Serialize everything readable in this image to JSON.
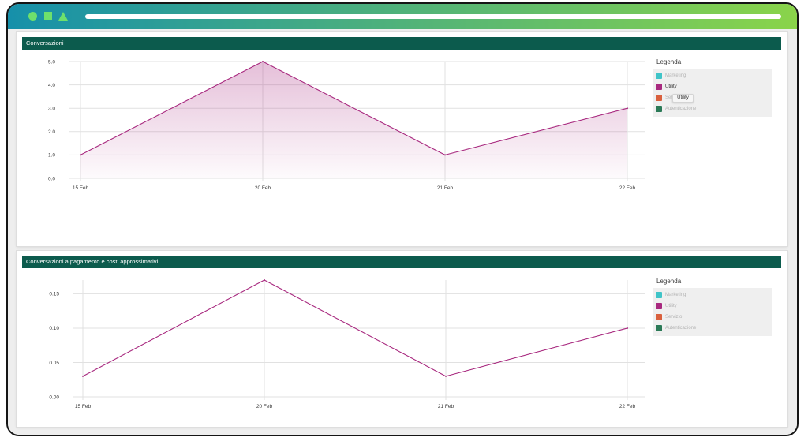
{
  "window": {
    "titlebar_gradient": [
      "#1690aa",
      "#8ad44a"
    ],
    "titlebar_icons": [
      "circle-icon",
      "square-icon",
      "triangle-icon"
    ],
    "icon_color": "#6ee06c",
    "address_bar_color": "#ffffff",
    "content_background": "#eeeeee"
  },
  "theme": {
    "header_color": "#0c5b4d",
    "legend_background": "#efefef"
  },
  "chart_data": [
    {
      "type": "area",
      "title": "Conversazioni",
      "categories": [
        "15 Feb",
        "20 Feb",
        "21 Feb",
        "22 Feb"
      ],
      "series": [
        {
          "name": "Utility",
          "values": [
            1,
            5,
            1,
            3
          ],
          "color": "#a8297f"
        }
      ],
      "ylim": [
        0,
        5
      ],
      "yticks": [
        "0.0",
        "1.0",
        "2.0",
        "3.0",
        "4.0",
        "5.0"
      ],
      "grid": true,
      "legend": {
        "title": "Legenda",
        "placement": "right",
        "items": [
          {
            "label": "Marketing",
            "color": "#40c4c8",
            "active": false
          },
          {
            "label": "Utility",
            "color": "#a8297f",
            "active": true
          },
          {
            "label": "Servizio",
            "color": "#d9603d",
            "active": false
          },
          {
            "label": "Autenticazione",
            "color": "#2b7a57",
            "active": false
          }
        ],
        "tooltip": "Utility"
      }
    },
    {
      "type": "line",
      "title": "Conversazioni a pagamento e costi approssimativi",
      "categories": [
        "15 Feb",
        "20 Feb",
        "21 Feb",
        "22 Feb"
      ],
      "series": [
        {
          "name": "Utility",
          "values": [
            0.03,
            0.17,
            0.03,
            0.1
          ],
          "color": "#a8297f"
        }
      ],
      "ylim": [
        0,
        0.17
      ],
      "yticks": [
        "0.00",
        "0.05",
        "0.10",
        "0.15"
      ],
      "grid": true,
      "legend": {
        "title": "Legenda",
        "placement": "right",
        "items": [
          {
            "label": "Marketing",
            "color": "#40c4c8",
            "active": false
          },
          {
            "label": "Utility",
            "color": "#a8297f",
            "active": false
          },
          {
            "label": "Servizio",
            "color": "#d9603d",
            "active": false
          },
          {
            "label": "Autenticazione",
            "color": "#2b7a57",
            "active": false
          }
        ]
      }
    }
  ]
}
